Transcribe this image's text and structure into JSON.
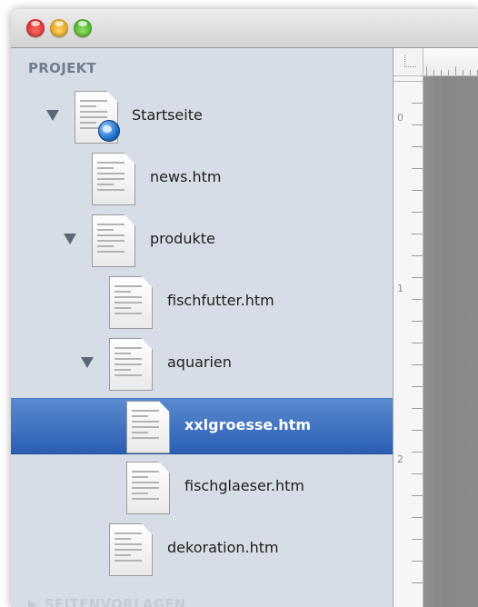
{
  "sidebar": {
    "section_title": "PROJEKT",
    "second_section_title": "SEITENVORLAGEN",
    "items": [
      {
        "label": "Startseite",
        "icon": "document-globe-icon",
        "expanded": true,
        "selected": false
      },
      {
        "label": "news.htm",
        "icon": "document-icon",
        "selected": false
      },
      {
        "label": "produkte",
        "icon": "document-icon",
        "expanded": true,
        "selected": false
      },
      {
        "label": "fischfutter.htm",
        "icon": "document-icon",
        "selected": false
      },
      {
        "label": "aquarien",
        "icon": "document-icon",
        "expanded": true,
        "selected": false
      },
      {
        "label": "xxlgroesse.htm",
        "icon": "document-icon",
        "selected": true
      },
      {
        "label": "fischglaeser.htm",
        "icon": "document-icon",
        "selected": false
      },
      {
        "label": "dekoration.htm",
        "icon": "document-icon",
        "selected": false
      }
    ]
  },
  "ruler": {
    "numbers": [
      "0",
      "1",
      "2"
    ]
  },
  "colors": {
    "selection": "#2a5eb3",
    "sidebar_bg": "#d6dde6",
    "canvas_bg": "#8e8e8e"
  }
}
